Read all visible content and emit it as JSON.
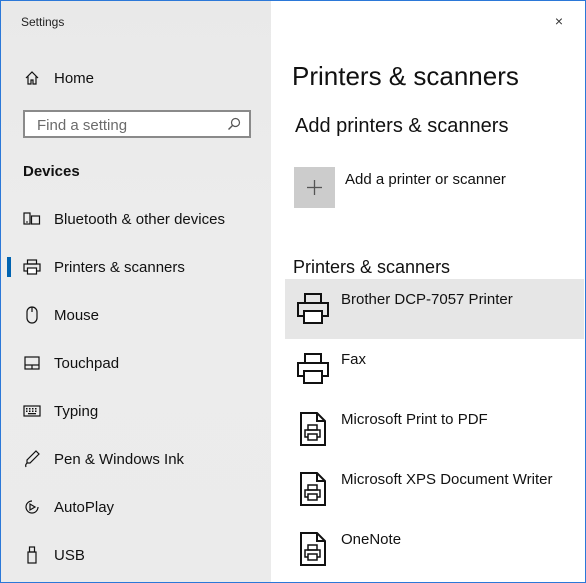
{
  "window": {
    "title": "Settings",
    "close_glyph": "×"
  },
  "sidebar": {
    "home_label": "Home",
    "search_placeholder": "Find a setting",
    "section_title": "Devices",
    "items": [
      {
        "label": "Bluetooth & other devices",
        "icon": "bluetooth-devices-icon"
      },
      {
        "label": "Printers & scanners",
        "icon": "printer-icon",
        "selected": true
      },
      {
        "label": "Mouse",
        "icon": "mouse-icon"
      },
      {
        "label": "Touchpad",
        "icon": "touchpad-icon"
      },
      {
        "label": "Typing",
        "icon": "keyboard-icon"
      },
      {
        "label": "Pen & Windows Ink",
        "icon": "pen-icon"
      },
      {
        "label": "AutoPlay",
        "icon": "autoplay-icon"
      },
      {
        "label": "USB",
        "icon": "usb-icon"
      }
    ]
  },
  "main": {
    "title": "Printers & scanners",
    "add_section_title": "Add printers & scanners",
    "add_button_label": "Add a printer or scanner",
    "add_button_glyph": "+",
    "list_title": "Printers & scanners",
    "devices": [
      {
        "name": "Brother DCP-7057 Printer",
        "icon": "printer-icon",
        "selected": true
      },
      {
        "name": "Fax",
        "icon": "printer-icon"
      },
      {
        "name": "Microsoft Print to PDF",
        "icon": "printer-document-icon"
      },
      {
        "name": "Microsoft XPS Document Writer",
        "icon": "printer-document-icon"
      },
      {
        "name": "OneNote",
        "icon": "printer-document-icon"
      }
    ]
  },
  "colors": {
    "accent": "#0063b1",
    "sidebar_bg": "#ebebeb",
    "selected_row": "#e6e6e6",
    "border": "#2b78d8"
  }
}
